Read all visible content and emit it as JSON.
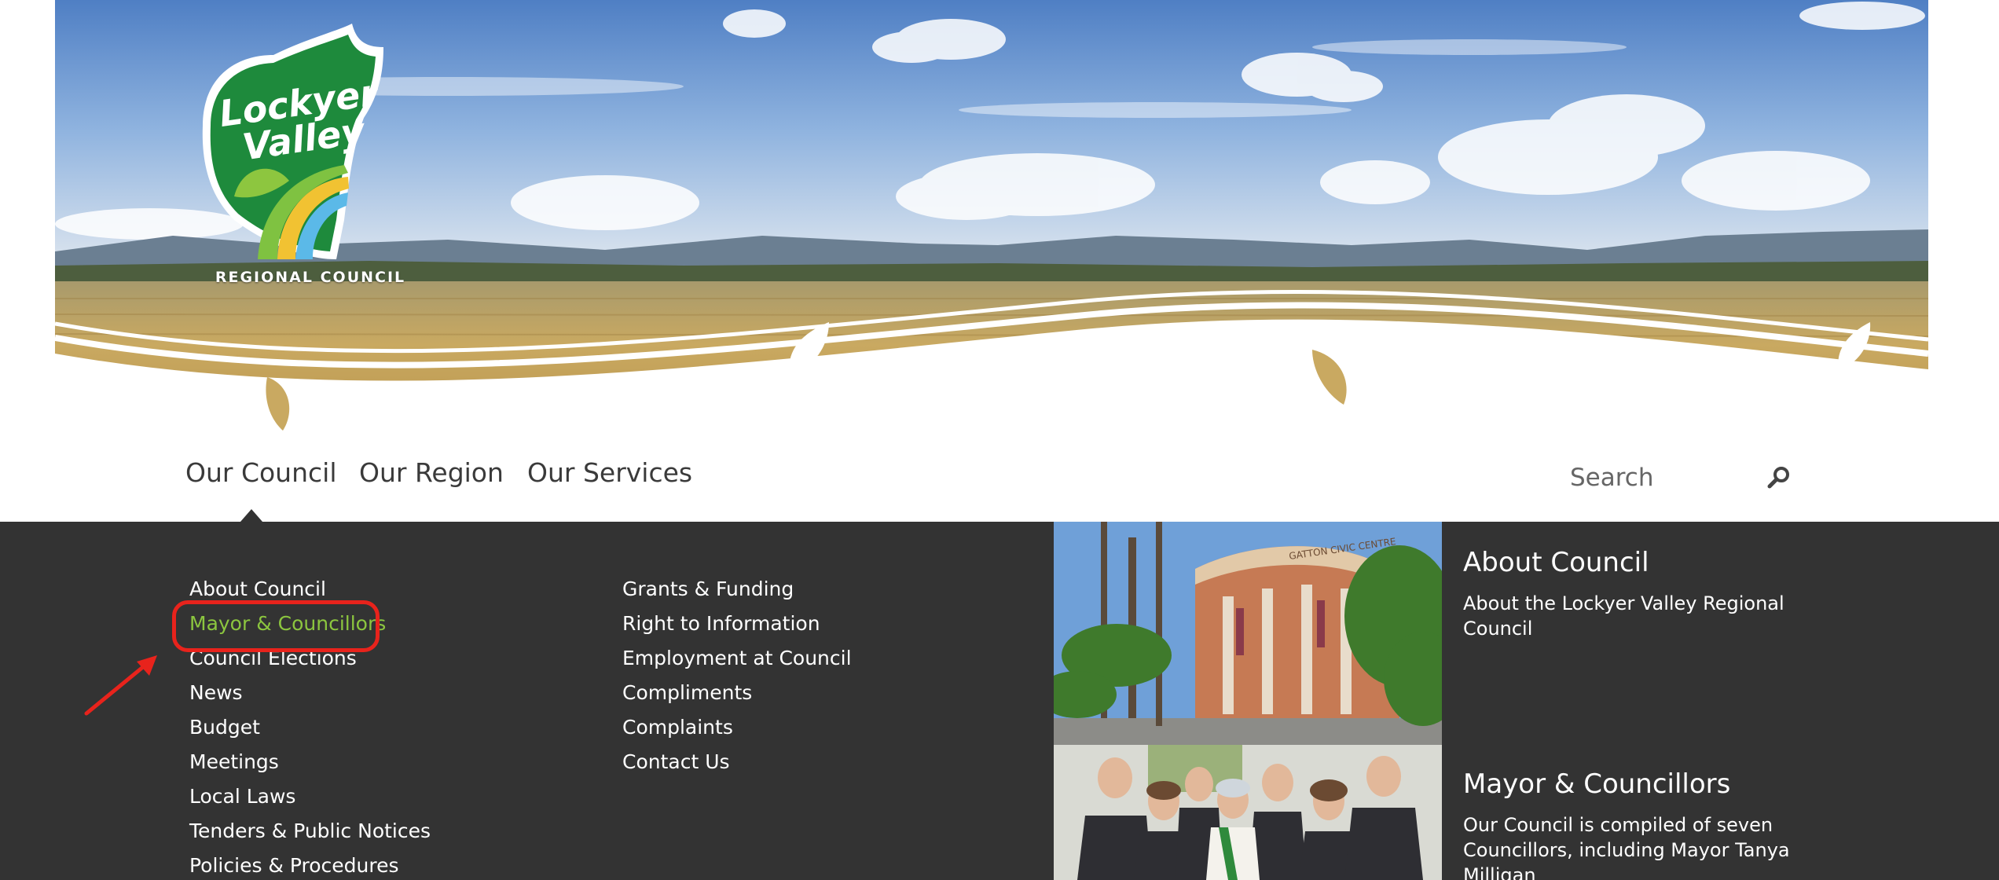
{
  "logo": {
    "line1": "Lockyer",
    "line2": "Valley",
    "subtitle": "REGIONAL COUNCIL"
  },
  "nav": {
    "items": [
      {
        "label": "Our Council"
      },
      {
        "label": "Our Region"
      },
      {
        "label": "Our Services"
      }
    ],
    "search_placeholder": "Search"
  },
  "menu": {
    "column1": [
      {
        "label": "About Council"
      },
      {
        "label": "Mayor & Councillors"
      },
      {
        "label": "Council Elections"
      },
      {
        "label": "News"
      },
      {
        "label": "Budget"
      },
      {
        "label": "Meetings"
      },
      {
        "label": "Local Laws"
      },
      {
        "label": "Tenders & Public Notices"
      },
      {
        "label": "Policies & Procedures"
      }
    ],
    "column2": [
      {
        "label": "Grants & Funding"
      },
      {
        "label": "Right to Information"
      },
      {
        "label": "Employment at Council"
      },
      {
        "label": "Compliments"
      },
      {
        "label": "Complaints"
      },
      {
        "label": "Contact Us"
      }
    ],
    "active_item": "Mayor & Councillors"
  },
  "features": [
    {
      "title": "About Council",
      "description": "About the Lockyer Valley Regional Council",
      "image_caption": "GATTON CIVIC CENTRE"
    },
    {
      "title": "Mayor & Councillors",
      "description": "Our Council is compiled of seven Councillors, including Mayor Tanya Milligan"
    }
  ],
  "colors": {
    "menu_background": "#333333",
    "active_link": "#8cc63f",
    "annotation": "#e8231c",
    "logo_green": "#1e8a3c"
  }
}
